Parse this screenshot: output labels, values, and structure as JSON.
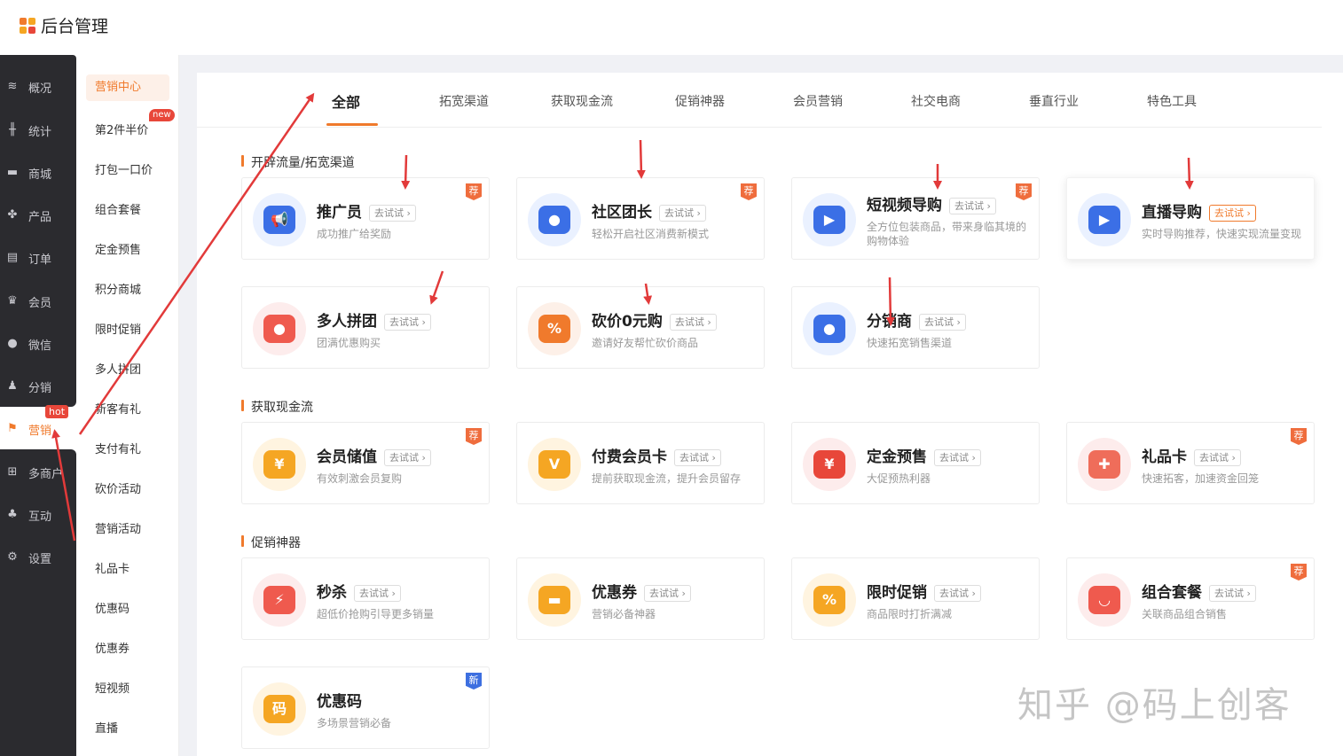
{
  "app": {
    "title": "后台管理"
  },
  "colors": {
    "accent": "#f07a2c",
    "dark_sidebar": "#2b2b2f",
    "hot": "#e8473a",
    "recommend": "#ef6d3d",
    "new_badge": "#3d6fe0"
  },
  "nav": [
    {
      "label": "概况",
      "icon": "layers-icon"
    },
    {
      "label": "统计",
      "icon": "chart-icon"
    },
    {
      "label": "商城",
      "icon": "store-icon"
    },
    {
      "label": "产品",
      "icon": "grid-icon"
    },
    {
      "label": "订单",
      "icon": "order-icon"
    },
    {
      "label": "会员",
      "icon": "crown-icon"
    },
    {
      "label": "微信",
      "icon": "chat-icon"
    },
    {
      "label": "分销",
      "icon": "users-icon"
    },
    {
      "label": "营销",
      "icon": "flag-icon",
      "active": true,
      "badge": "hot"
    },
    {
      "label": "多商户",
      "icon": "shop-plus-icon"
    },
    {
      "label": "互动",
      "icon": "interact-icon"
    },
    {
      "label": "设置",
      "icon": "gear-icon"
    }
  ],
  "subnav": [
    {
      "label": "营销中心",
      "active": true
    },
    {
      "label": "第2件半价",
      "badge": "new"
    },
    {
      "label": "打包一口价"
    },
    {
      "label": "组合套餐"
    },
    {
      "label": "定金预售"
    },
    {
      "label": "积分商城"
    },
    {
      "label": "限时促销"
    },
    {
      "label": "多人拼团"
    },
    {
      "label": "新客有礼"
    },
    {
      "label": "支付有礼"
    },
    {
      "label": "砍价活动"
    },
    {
      "label": "营销活动"
    },
    {
      "label": "礼品卡"
    },
    {
      "label": "优惠码"
    },
    {
      "label": "优惠券"
    },
    {
      "label": "短视频"
    },
    {
      "label": "直播"
    }
  ],
  "tabs": [
    {
      "label": "全部",
      "active": true
    },
    {
      "label": "拓宽渠道"
    },
    {
      "label": "获取现金流"
    },
    {
      "label": "促销神器"
    },
    {
      "label": "会员营销"
    },
    {
      "label": "社交电商"
    },
    {
      "label": "垂直行业"
    },
    {
      "label": "特色工具"
    }
  ],
  "try_label": "去试试",
  "sections": [
    {
      "title": "开辟流量/拓宽渠道",
      "cards": [
        {
          "title": "推广员",
          "desc": "成功推广给奖励",
          "badge": "荐",
          "icon": "megaphone-icon"
        },
        {
          "title": "社区团长",
          "desc": "轻松开启社区消费新模式",
          "badge": "荐",
          "icon": "community-leader-icon"
        },
        {
          "title": "短视频导购",
          "desc": "全方位包装商品，带来身临其境的购物体验",
          "badge": "荐",
          "icon": "video-bag-icon"
        },
        {
          "title": "直播导购",
          "desc": "实时导购推荐，快速实现流量变现",
          "icon": "clapper-icon",
          "selected": true
        },
        {
          "title": "多人拼团",
          "desc": "团满优惠购买",
          "icon": "group-buy-icon"
        },
        {
          "title": "砍价0元购",
          "desc": "邀请好友帮忙砍价商品",
          "icon": "price-tag-icon"
        },
        {
          "title": "分销商",
          "desc": "快速拓宽销售渠道",
          "icon": "distributor-icon"
        }
      ]
    },
    {
      "title": "获取现金流",
      "cards": [
        {
          "title": "会员储值",
          "desc": "有效刺激会员复购",
          "badge": "荐",
          "icon": "coin-icon"
        },
        {
          "title": "付费会员卡",
          "desc": "提前获取现金流，提升会员留存",
          "icon": "vip-card-icon"
        },
        {
          "title": "定金预售",
          "desc": "大促预热利器",
          "icon": "deposit-icon"
        },
        {
          "title": "礼品卡",
          "desc": "快速拓客，加速资金回笼",
          "badge": "荐",
          "icon": "gift-icon"
        }
      ]
    },
    {
      "title": "促销神器",
      "cards": [
        {
          "title": "秒杀",
          "desc": "超低价抢购引导更多销量",
          "icon": "flash-clock-icon"
        },
        {
          "title": "优惠券",
          "desc": "营销必备神器",
          "icon": "coupon-icon"
        },
        {
          "title": "限时促销",
          "desc": "商品限时打折满减",
          "icon": "percent-tag-icon"
        },
        {
          "title": "组合套餐",
          "desc": "关联商品组合销售",
          "badge": "荐",
          "icon": "bundle-icon"
        },
        {
          "title": "优惠码",
          "desc": "多场景营销必备",
          "badge": "新",
          "icon": "promo-code-icon",
          "no_try": true
        }
      ]
    }
  ],
  "promo_code_glyph": "码",
  "watermark": "知乎 @码上创客"
}
